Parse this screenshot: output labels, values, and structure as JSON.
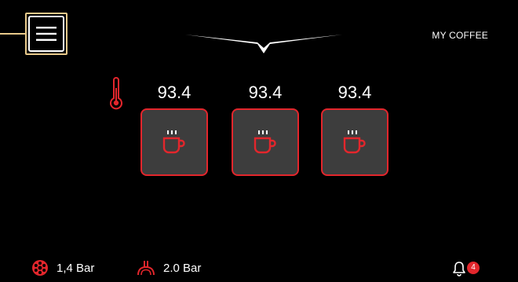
{
  "header": {
    "title": "MY COFFEE",
    "menu_icon": "hamburger-menu-icon",
    "logo_icon": "wings-logo-icon"
  },
  "groups": [
    {
      "temperature": "93.4",
      "icon": "coffee-cup-icon"
    },
    {
      "temperature": "93.4",
      "icon": "coffee-cup-icon"
    },
    {
      "temperature": "93.4",
      "icon": "coffee-cup-icon"
    }
  ],
  "temperature_icon": "thermometer-icon",
  "status": {
    "pump_pressure": "1,4 Bar",
    "pump_icon": "pump-wheel-icon",
    "boiler_pressure": "2.0 Bar",
    "boiler_icon": "steam-pressure-icon"
  },
  "notifications": {
    "icon": "bell-icon",
    "count": "4"
  },
  "colors": {
    "accent": "#e3262c",
    "highlight": "#e8c98a",
    "tile": "#3d3d3d",
    "background": "#000000"
  }
}
